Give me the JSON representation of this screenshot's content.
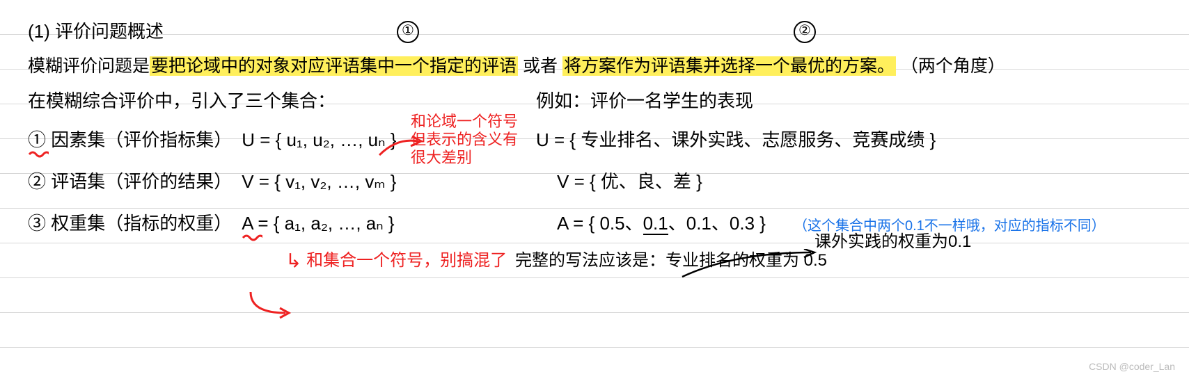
{
  "title": {
    "number": "(1)",
    "text": "评价问题概述"
  },
  "markers": {
    "one": "①",
    "two": "②"
  },
  "definition": {
    "prefix": "模糊评价问题是",
    "hl1": "要把论域中的对象对应评语集中一个指定的评语",
    "mid": " 或者 ",
    "hl2": "将方案作为评语集并选择一个最优的方案。",
    "suffix": "（两个角度）"
  },
  "intro": "在模糊综合评价中，引入了三个集合：",
  "example_intro": "例如：评价一名学生的表现",
  "sets": {
    "factor": {
      "num": "①",
      "label": "因素集（评价指标集）",
      "formula": "U = { u₁, u₂, …, uₙ }",
      "example": "U = { 专业排名、课外实践、志愿服务、竞赛成绩 }"
    },
    "comment": {
      "num": "②",
      "label": "评语集（评价的结果）",
      "formula": "V = { v₁, v₂, …, vₘ }",
      "example": "V = { 优、良、差 }"
    },
    "weight": {
      "num": "③",
      "label": "权重集（指标的权重）",
      "formula": "A = { a₁, a₂, …, aₙ }",
      "example_pre": "A = { 0.5、",
      "example_ul": "0.1",
      "example_post": "、0.1、0.3 }"
    }
  },
  "notes": {
    "red1": "和论域一个符号\n但表示的含义有\n很大差别",
    "red2": "和集合一个符号，别搞混了",
    "black_arrow": "课外实践的权重为0.1",
    "black_below": "完整的写法应该是：专业排名的权重为 0.5",
    "blue": "（这个集合中两个0.1不一样哦，对应的指标不同）"
  },
  "watermark": "CSDN @coder_Lan"
}
